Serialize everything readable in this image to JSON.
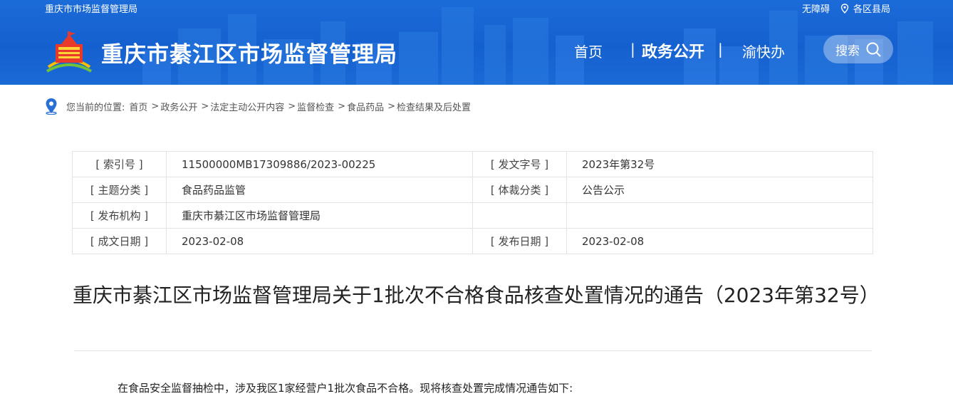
{
  "header": {
    "top_left": "重庆市市场监督管理局",
    "accessibility": "无障碍",
    "regions": "各区县局",
    "site_title": "重庆市綦江区市场监督管理局",
    "nav": {
      "home": "首页",
      "sep": "|",
      "gov_open": "政务公开",
      "yukuaiban": "渝快办"
    },
    "search_label": "搜索"
  },
  "breadcrumb": {
    "prefix": "您当前的位置:",
    "items": [
      "首页",
      "政务公开",
      "法定主动公开内容",
      "监督检查",
      "食品药品",
      "检查结果及后处置"
    ],
    "arrow": ">"
  },
  "meta": {
    "index_label": "[ 索引号 ]",
    "index_value": "11500000MB17309886/2023-00225",
    "doc_no_label": "[ 发文字号 ]",
    "doc_no_value": "2023年第32号",
    "topic_label": "[ 主题分类 ]",
    "topic_value": "食品药品监管",
    "genre_label": "[ 体裁分类 ]",
    "genre_value": "公告公示",
    "org_label": "[ 发布机构 ]",
    "org_value": "重庆市綦江区市场监督管理局",
    "created_label": "[ 成文日期 ]",
    "created_value": "2023-02-08",
    "published_label": "[ 发布日期 ]",
    "published_value": "2023-02-08"
  },
  "article": {
    "title": "重庆市綦江区市场监督管理局关于1批次不合格食品核查处置情况的通告（2023年第32号）",
    "intro": "在食品安全监督抽检中，涉及我区1家经营户1批次食品不合格。现将核查处置完成情况通告如下:"
  },
  "colors": {
    "header_blue": "#1560cf",
    "text_dark": "#222222",
    "border": "#e3e3e3"
  },
  "icons": [
    "location-pin-icon",
    "search-icon",
    "emblem-logo"
  ]
}
